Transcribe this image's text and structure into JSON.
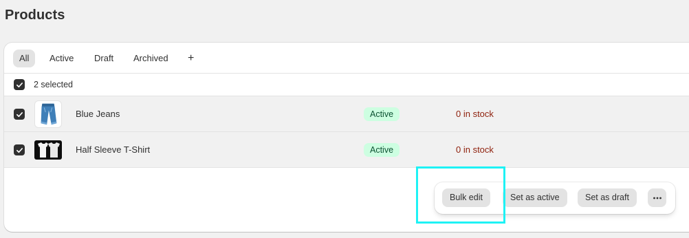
{
  "page": {
    "title": "Products"
  },
  "tabs": [
    {
      "label": "All",
      "selected": true
    },
    {
      "label": "Active",
      "selected": false
    },
    {
      "label": "Draft",
      "selected": false
    },
    {
      "label": "Archived",
      "selected": false
    },
    {
      "label": "+",
      "selected": false
    }
  ],
  "selection": {
    "label": "2 selected",
    "all_checked": true
  },
  "products": [
    {
      "name": "Blue Jeans",
      "status": "Active",
      "inventory": "0 in stock",
      "checked": true,
      "thumbnail_icon": "jeans-icon"
    },
    {
      "name": "Half Sleeve T-Shirt",
      "status": "Active",
      "inventory": "0 in stock",
      "checked": true,
      "thumbnail_icon": "tshirt-icon"
    }
  ],
  "bulk_actions": {
    "bulk_edit": "Bulk edit",
    "set_active": "Set as active",
    "set_draft": "Set as draft",
    "more_icon": "ellipsis-icon"
  },
  "colors": {
    "background": "#f1f1f1",
    "status_active_bg": "#cdfee1",
    "status_active_text": "#0c5132",
    "out_of_stock_text": "#8e1f0b",
    "highlight": "#1ef2f5"
  }
}
